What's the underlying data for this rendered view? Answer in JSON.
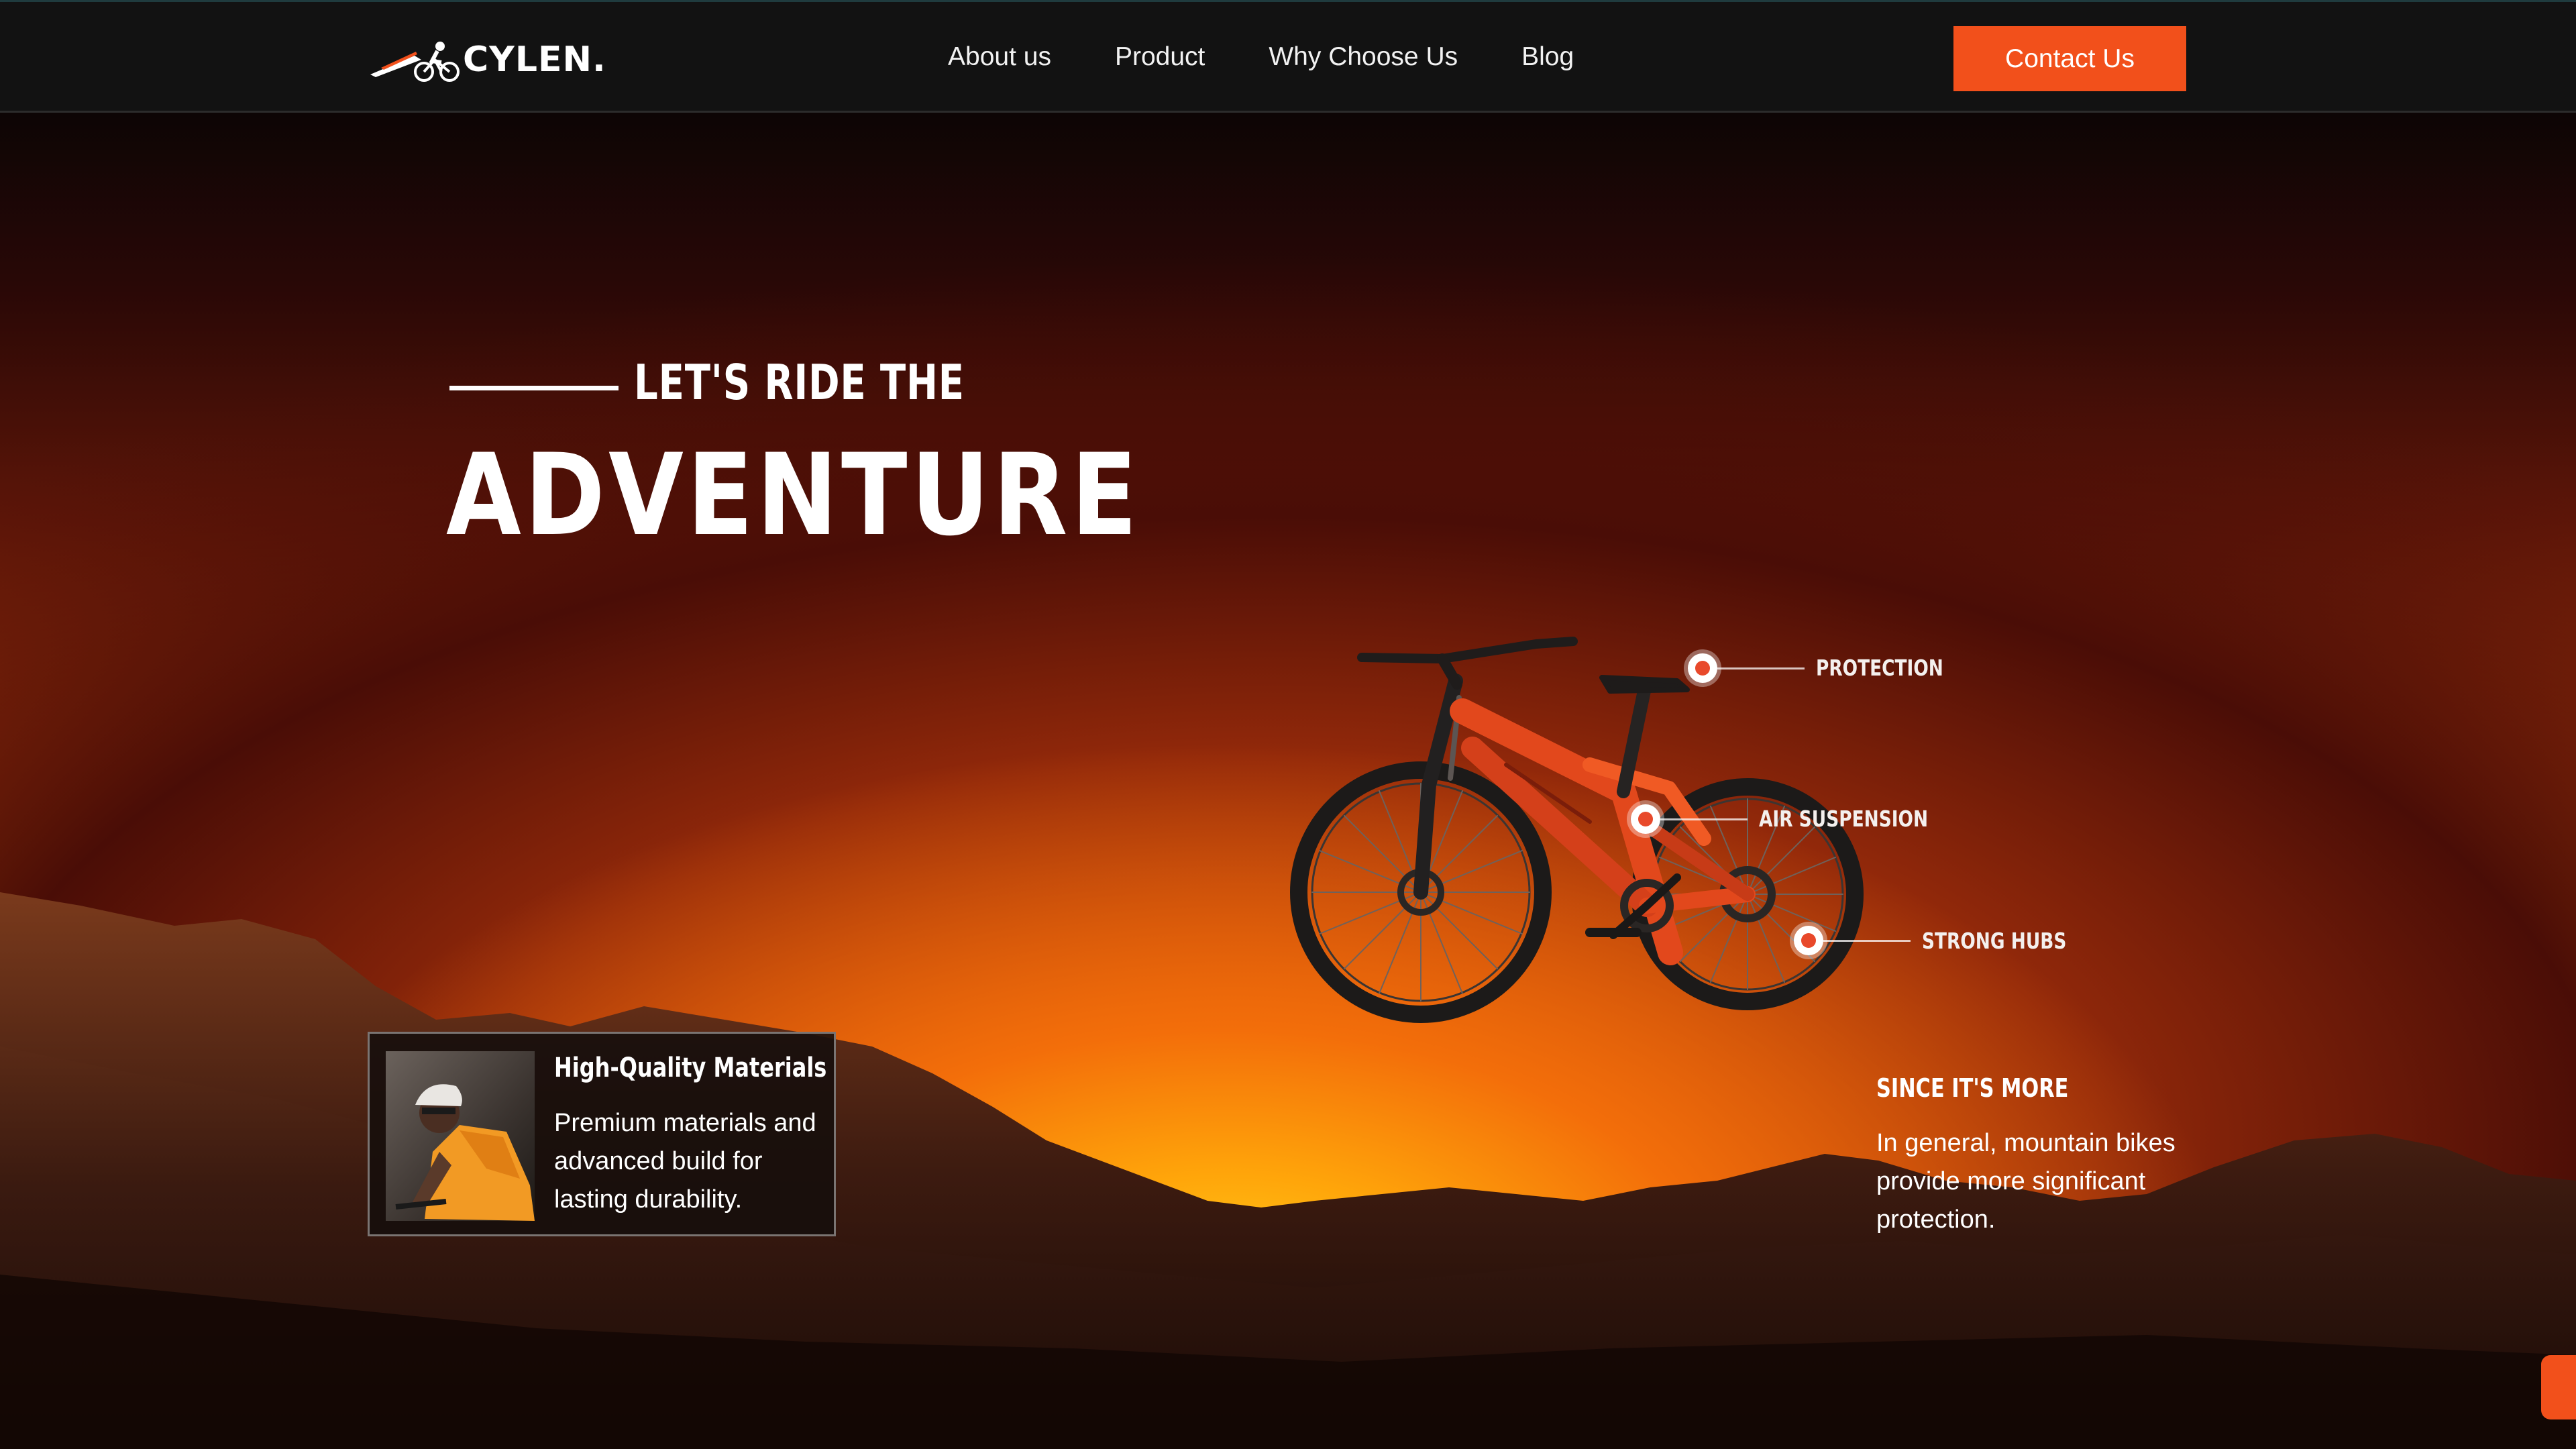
{
  "header": {
    "brand": "CYLEN.",
    "logo_icon": "cyclist-icon",
    "nav": [
      "About us",
      "Product",
      "Why Choose Us",
      "Blog"
    ],
    "cta": "Contact Us"
  },
  "hero": {
    "eyebrow": "LET'S RIDE THE",
    "headline": "ADVENTURE"
  },
  "bike": {
    "callouts": [
      "PROTECTION",
      "AIR SUSPENSION",
      "STRONG HUBS"
    ]
  },
  "since": {
    "title": "SINCE IT'S MORE",
    "body": "In general, mountain bikes provide more significant protection."
  },
  "feature_card": {
    "title": "High-Quality Materials",
    "body": "Premium materials and advanced build for lasting durability."
  },
  "colors": {
    "accent": "#f2501b",
    "header_bg": "#121212",
    "hotspot": "#e8492b"
  }
}
